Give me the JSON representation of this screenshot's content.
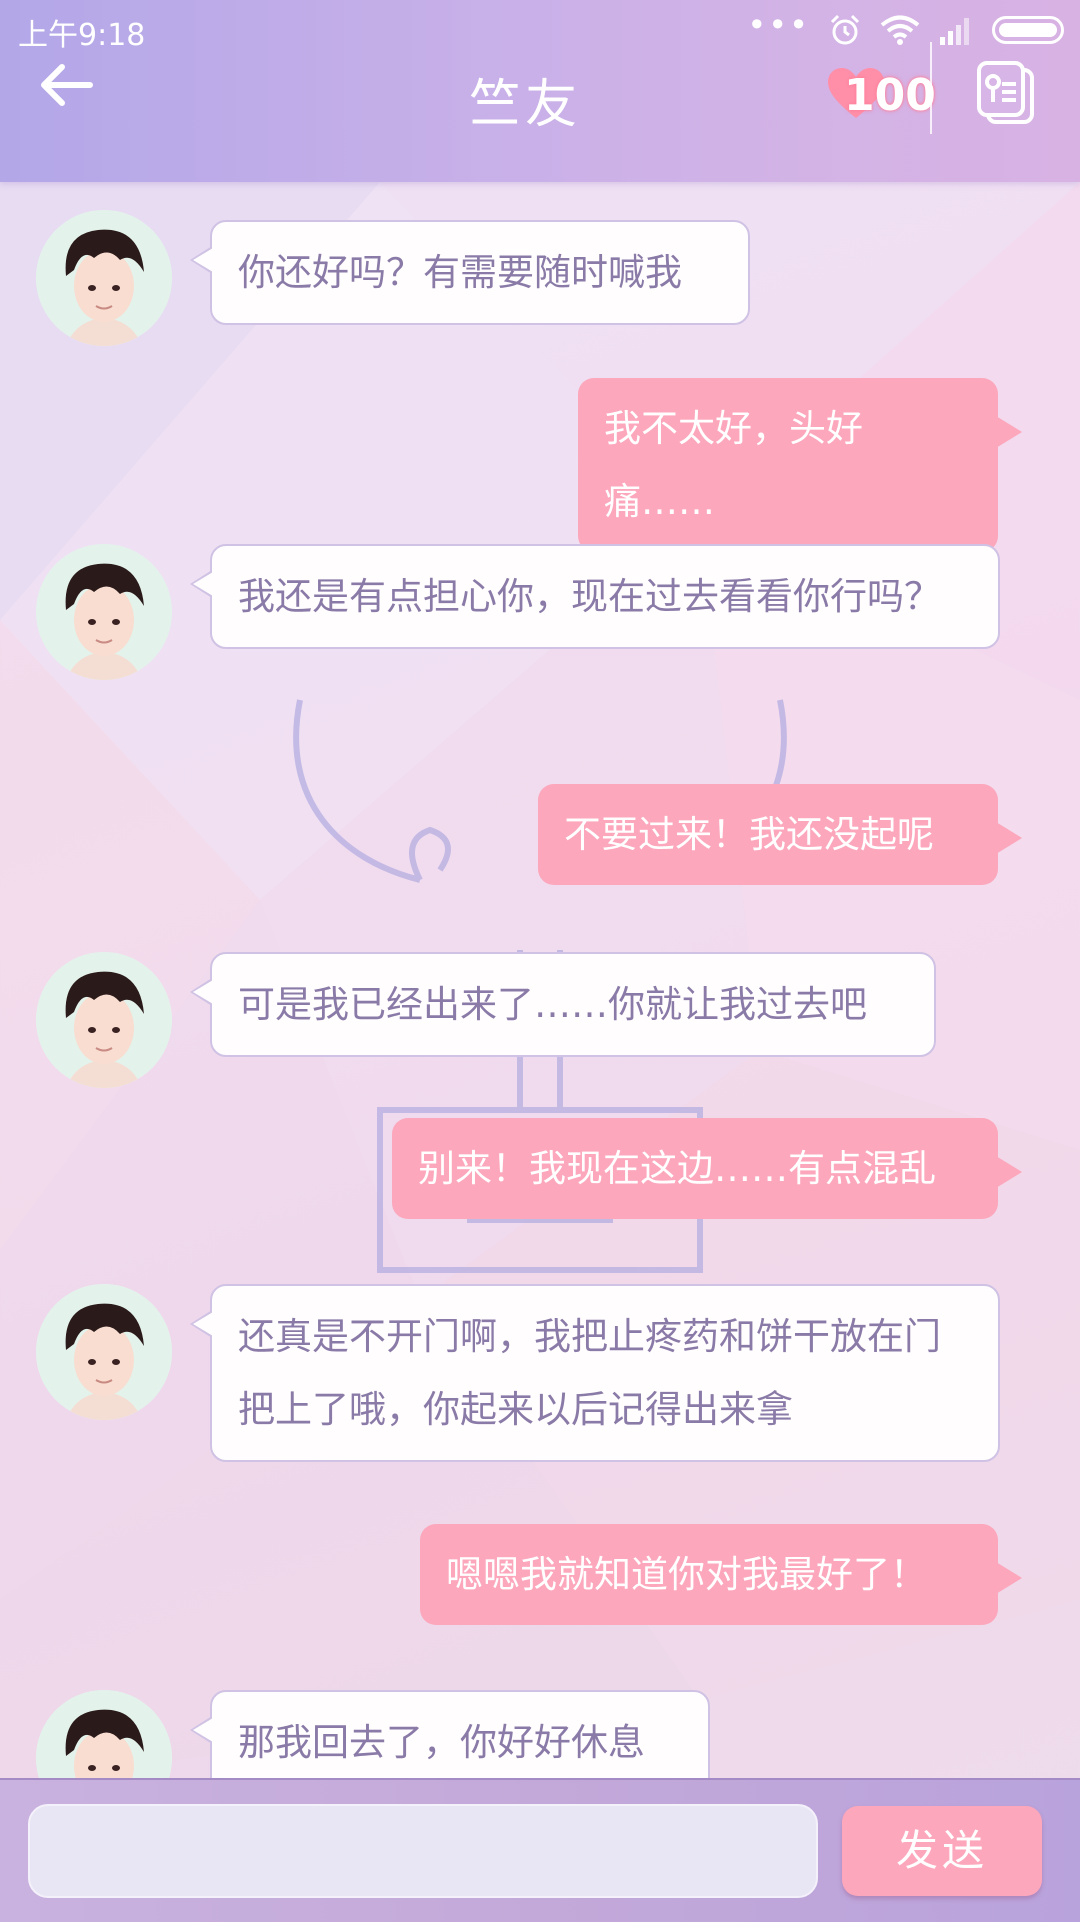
{
  "status_bar": {
    "time": "上午9:18",
    "dots": "•••",
    "icons": [
      "alarm-icon",
      "wifi-icon",
      "signal-icon",
      "battery-icon"
    ]
  },
  "header": {
    "title": "竺友",
    "affection": "100",
    "back_icon": "arrow-left-icon",
    "profile_icon": "contact-card-icon"
  },
  "messages": [
    {
      "side": "in",
      "text": "你还好吗？有需要随时喊我"
    },
    {
      "side": "out",
      "text": "我不太好，头好痛……"
    },
    {
      "side": "in",
      "text": "我还是有点担心你，现在过去看看你行吗？"
    },
    {
      "side": "out",
      "text": "不要过来！我还没起呢"
    },
    {
      "side": "in",
      "text": "可是我已经出来了……你就让我过去吧"
    },
    {
      "side": "out",
      "text": "别来！我现在这边……有点混乱"
    },
    {
      "side": "in",
      "text": "还真是不开门啊，我把止疼药和饼干放在门把上了哦，你起来以后记得出来拿"
    },
    {
      "side": "out",
      "text": "嗯嗯我就知道你对我最好了！"
    },
    {
      "side": "in",
      "text": "那我回去了，你好好休息"
    }
  ],
  "composer": {
    "input_value": "",
    "send_label": "发送"
  },
  "colors": {
    "header_gradient_start": "#b3a7e8",
    "header_gradient_end": "#d8b2e3",
    "outgoing_bubble": "#fca7bc",
    "incoming_text": "#8a7aa7",
    "send_button": "#fca7bc"
  }
}
